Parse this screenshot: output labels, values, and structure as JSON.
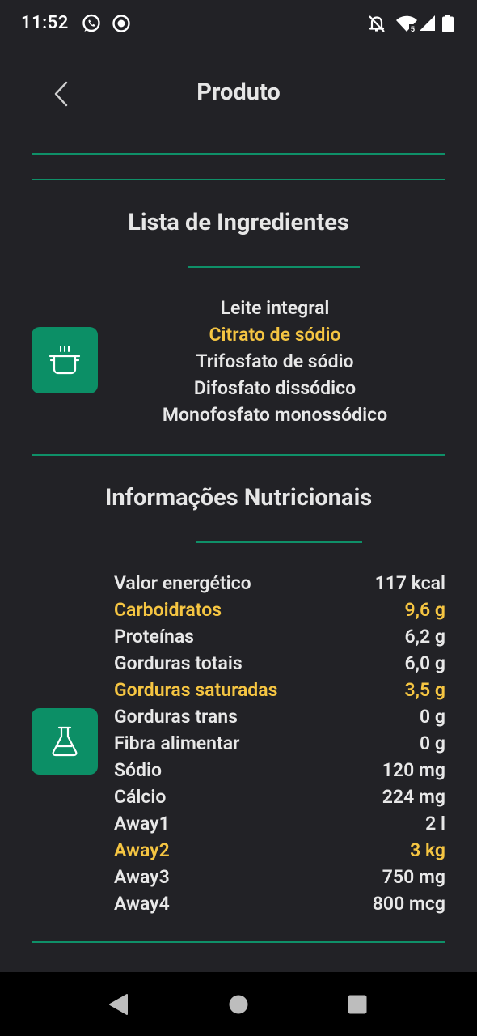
{
  "status_bar": {
    "time": "11:52",
    "left_icons": [
      "whatsapp-icon",
      "record-icon"
    ],
    "right_icons": [
      "bell-off-icon",
      "wifi-icon",
      "signal-icon",
      "battery-icon"
    ]
  },
  "header": {
    "title": "Produto",
    "back_icon": "chevron-left-icon"
  },
  "ingredients_section": {
    "title": "Lista de Ingredientes",
    "icon": "cooking-pot-icon",
    "items": [
      {
        "label": "Leite integral",
        "highlight": false
      },
      {
        "label": "Citrato de sódio",
        "highlight": true
      },
      {
        "label": "Trifosfato de sódio",
        "highlight": false
      },
      {
        "label": "Difosfato dissódico",
        "highlight": false
      },
      {
        "label": "Monofosfato monossódico",
        "highlight": false
      }
    ]
  },
  "nutrition_section": {
    "title": "Informações Nutricionais",
    "icon": "flask-icon",
    "rows": [
      {
        "name": "Valor energético",
        "value": "117 kcal",
        "highlight": false
      },
      {
        "name": "Carboidratos",
        "value": "9,6 g",
        "highlight": true
      },
      {
        "name": "Proteínas",
        "value": "6,2 g",
        "highlight": false
      },
      {
        "name": "Gorduras totais",
        "value": "6,0 g",
        "highlight": false
      },
      {
        "name": "Gorduras saturadas",
        "value": "3,5 g",
        "highlight": true
      },
      {
        "name": "Gorduras trans",
        "value": "0 g",
        "highlight": false
      },
      {
        "name": "Fibra alimentar",
        "value": "0 g",
        "highlight": false
      },
      {
        "name": "Sódio",
        "value": "120 mg",
        "highlight": false
      },
      {
        "name": "Cálcio",
        "value": "224 mg",
        "highlight": false
      },
      {
        "name": "Away1",
        "value": "2 l",
        "highlight": false
      },
      {
        "name": "Away2",
        "value": "3 kg",
        "highlight": true
      },
      {
        "name": "Away3",
        "value": "750 mg",
        "highlight": false
      },
      {
        "name": "Away4",
        "value": "800 mcg",
        "highlight": false
      }
    ]
  },
  "nav_bar": {
    "buttons": [
      "back-triangle-icon",
      "home-circle-icon",
      "recents-square-icon"
    ]
  },
  "colors": {
    "background": "#222226",
    "accent_green": "#0c8f66",
    "highlight_yellow": "#f5c542",
    "text": "#e8e8e8"
  }
}
